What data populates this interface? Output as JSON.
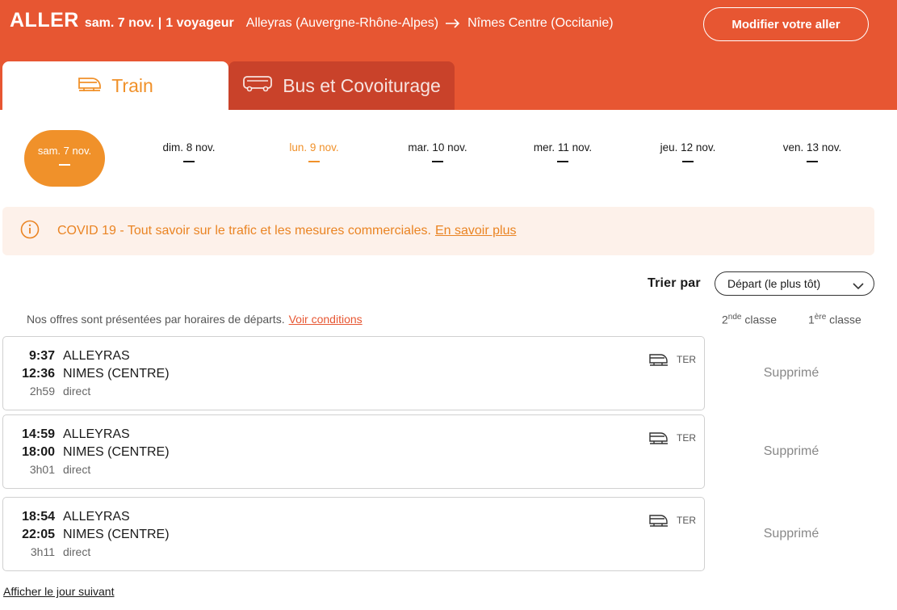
{
  "header": {
    "direction": "ALLER",
    "date": "sam. 7 nov.",
    "separator": "|",
    "passengers": "1 voyageur",
    "origin": "Alleyras (Auvergne-Rhône-Alpes)",
    "destination": "Nîmes Centre (Occitanie)",
    "modify_label": "Modifier votre aller"
  },
  "tabs": [
    {
      "label": "Train",
      "icon": "train-icon"
    },
    {
      "label": "Bus et Covoiturage",
      "icon": "bus-car-icon"
    }
  ],
  "dates": [
    {
      "label": "sam. 7 nov.",
      "price": "—"
    },
    {
      "label": "dim. 8 nov.",
      "price": "—"
    },
    {
      "label": "lun. 9 nov.",
      "price": "—"
    },
    {
      "label": "mar. 10 nov.",
      "price": "—"
    },
    {
      "label": "mer. 11 nov.",
      "price": "—"
    },
    {
      "label": "jeu. 12 nov.",
      "price": "—"
    },
    {
      "label": "ven. 13 nov.",
      "price": "—"
    }
  ],
  "covid": {
    "text": "COVID 19 - Tout savoir sur le trafic et les mesures commerciales.",
    "link": "En savoir plus"
  },
  "sort": {
    "label": "Trier par",
    "selected": "Départ (le plus tôt)"
  },
  "offers_note": {
    "text": "Nos offres sont présentées par horaires de départs.",
    "link": "Voir conditions"
  },
  "classes": {
    "second_num": "2",
    "second_sup": "nde",
    "second_word": "classe",
    "first_num": "1",
    "first_sup": "ère",
    "first_word": "classe"
  },
  "journeys": [
    {
      "dep_time": "9:37",
      "dep_station": "ALLEYRAS",
      "arr_time": "12:36",
      "arr_station": "NIMES (CENTRE)",
      "duration": "2h59",
      "type": "direct",
      "mode": "TER",
      "status": "Supprimé"
    },
    {
      "dep_time": "14:59",
      "dep_station": "ALLEYRAS",
      "arr_time": "18:00",
      "arr_station": "NIMES (CENTRE)",
      "duration": "3h01",
      "type": "direct",
      "mode": "TER",
      "status": "Supprimé"
    },
    {
      "dep_time": "18:54",
      "dep_station": "ALLEYRAS",
      "arr_time": "22:05",
      "arr_station": "NIMES (CENTRE)",
      "duration": "3h11",
      "type": "direct",
      "mode": "TER",
      "status": "Supprimé"
    }
  ],
  "next_day_link": "Afficher le jour suivant",
  "colors": {
    "header_bg": "#e75632",
    "accent_orange": "#f0912a",
    "bus_tab_bg": "#c9422a",
    "covid_bg": "#fdf1ea"
  }
}
